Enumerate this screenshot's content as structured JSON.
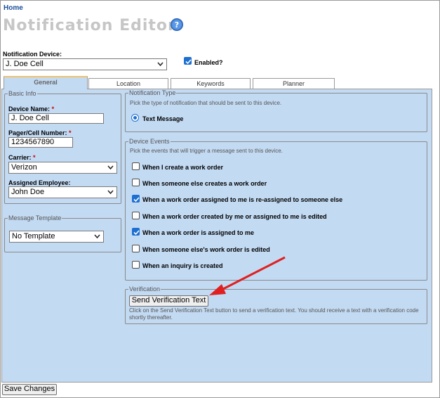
{
  "breadcrumb": {
    "home": "Home"
  },
  "page": {
    "title": "Notification Editor"
  },
  "device": {
    "label": "Notification Device:",
    "selected": "J. Doe Cell",
    "enabled_label": "Enabled?",
    "enabled": true
  },
  "tabs": [
    {
      "label": "General",
      "active": true
    },
    {
      "label": "Location",
      "active": false
    },
    {
      "label": "Keywords",
      "active": false
    },
    {
      "label": "Planner",
      "active": false
    }
  ],
  "basic_info": {
    "legend": "Basic Info",
    "device_name_label": "Device Name:",
    "device_name_value": "J. Doe Cell",
    "pager_label": "Pager/Cell Number:",
    "pager_value": "1234567890",
    "carrier_label": "Carrier:",
    "carrier_value": "Verizon",
    "employee_label": "Assigned Employee:",
    "employee_value": "John Doe",
    "required_mark": "*"
  },
  "message_template": {
    "legend": "Message Template",
    "value": "No Template"
  },
  "notification_type": {
    "legend": "Notification Type",
    "hint": "Pick the type of notification that should be sent to this device.",
    "option": "Text Message"
  },
  "device_events": {
    "legend": "Device Events",
    "hint": "Pick the events that will trigger a message sent to this device.",
    "events": [
      {
        "label": "When I create a work order",
        "checked": false
      },
      {
        "label": "When someone else creates a work order",
        "checked": false
      },
      {
        "label": "When a work order assigned to me is re-assigned to someone else",
        "checked": true
      },
      {
        "label": "When a work order created by me or assigned to me is edited",
        "checked": false
      },
      {
        "label": "When a work order is assigned to me",
        "checked": true
      },
      {
        "label": "When someone else's work order is edited",
        "checked": false
      },
      {
        "label": "When an inquiry is created",
        "checked": false
      }
    ]
  },
  "verification": {
    "legend": "Verification",
    "button": "Send Verification Text",
    "text": "Click on the Send Verification Text button to send a verification text. You should receive a text with a verification code shortly thereafter."
  },
  "footer": {
    "save": "Save Changes"
  },
  "colors": {
    "panel": "#c3daf3",
    "link": "#1a4d9b",
    "accent": "#1d6fd1",
    "arrow": "#e02020",
    "title": "#c6c6c6"
  }
}
